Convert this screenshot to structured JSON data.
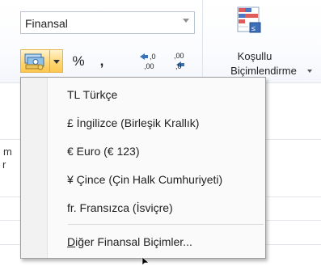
{
  "ribbon": {
    "number_format_combo": {
      "value": "Finansal"
    },
    "toolbar": {
      "currency_button_icon": "money-bills-icon",
      "percent_label": "%",
      "comma_label": ",",
      "increase_decimal_icon": "increase-decimal-icon",
      "decrease_decimal_icon": "decrease-decimal-icon"
    },
    "conditional_formatting": {
      "icon": "conditional-formatting-icon",
      "label_line1": "Koşullu",
      "label_line2": "Biçimlendirme"
    }
  },
  "sheet_peek": {
    "column_fragment": "m",
    "row_fragment": "r"
  },
  "currency_menu": {
    "items": [
      {
        "label": "TL Türkçe"
      },
      {
        "label": "£ İngilizce (Birleşik Krallık)"
      },
      {
        "label": "€ Euro (€ 123)"
      },
      {
        "label": "¥ Çince (Çin Halk Cumhuriyeti)"
      },
      {
        "label": "fr. Fransızca (İsviçre)"
      }
    ],
    "more_formats": {
      "mnemonic": "D",
      "rest": "iğer Finansal Biçimler..."
    }
  },
  "colors": {
    "accent_button": "#ffd777",
    "menu_border": "#9e9e9e",
    "menu_background": "#fafafa"
  }
}
